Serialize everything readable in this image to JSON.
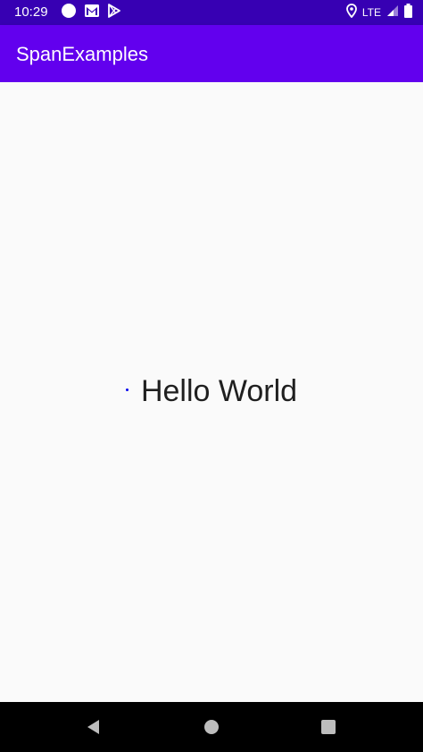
{
  "status_bar": {
    "time": "10:29",
    "network_label": "LTE",
    "icons": [
      "circle-notification-icon",
      "gmail-icon",
      "play-store-icon",
      "location-icon",
      "signal-icon",
      "battery-icon"
    ]
  },
  "app_bar": {
    "title": "SpanExamples"
  },
  "content": {
    "text": "Hello World",
    "bullet_color": "#0000ee"
  },
  "navigation_bar": {
    "icons": [
      "back-icon",
      "home-icon",
      "recents-icon"
    ]
  },
  "colors": {
    "status_bar": "#3700b3",
    "app_bar": "#6200ee",
    "background": "#fafafa",
    "nav_bar": "#000000"
  }
}
